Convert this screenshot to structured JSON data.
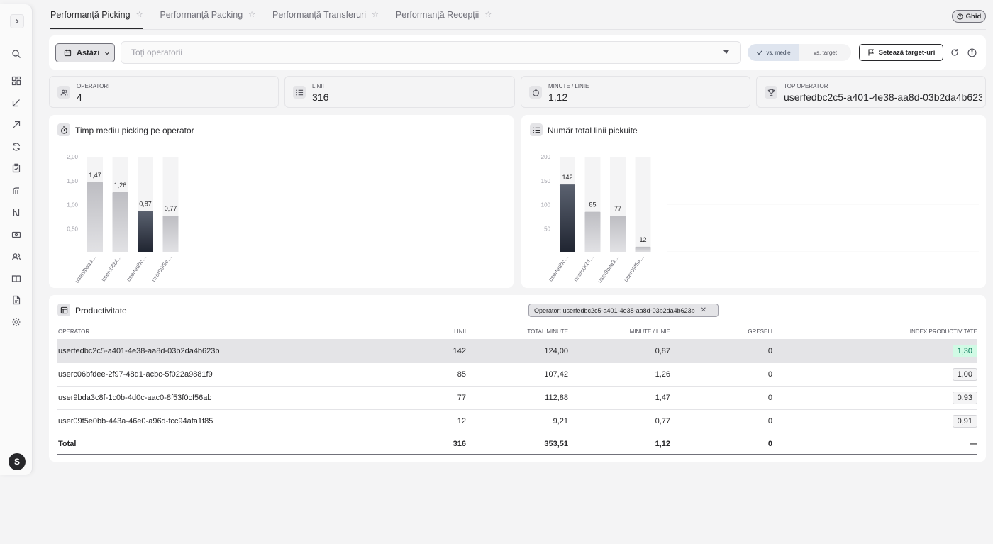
{
  "tabs": [
    {
      "label": "Performanță Picking",
      "active": true
    },
    {
      "label": "Performanță Packing",
      "active": false
    },
    {
      "label": "Performanță Transferuri",
      "active": false
    },
    {
      "label": "Performanță Recepții",
      "active": false
    }
  ],
  "header": {
    "ghid_label": "Ghid"
  },
  "filters": {
    "date_label": "Astăzi",
    "operator_placeholder": "Toți operatorii",
    "compare_options": [
      "vs. medie",
      "vs. target"
    ],
    "compare_selected": "vs. medie",
    "target_button_label": "Setează target-uri"
  },
  "kpis": [
    {
      "label": "Operatori",
      "value": "4",
      "icon": "users-icon"
    },
    {
      "label": "Linii",
      "value": "316",
      "icon": "list-icon"
    },
    {
      "label": "Minute / linie",
      "value": "1,12",
      "icon": "timer-icon"
    },
    {
      "label": "Top operator",
      "value": "userfedbc2c5-a401-4e38-aa8d-03b2da4b623b",
      "icon": "trophy-icon"
    }
  ],
  "user": {
    "avatar_initial": "S"
  },
  "chart_data": [
    {
      "type": "bar",
      "title": "Timp mediu picking pe operator",
      "categories": [
        "user9bda3…",
        "userc06bf…",
        "userfedbc…",
        "user09f5e…"
      ],
      "values": [
        1.47,
        1.26,
        0.87,
        0.77
      ],
      "value_labels": [
        "1,47",
        "1,26",
        "0,87",
        "0,77"
      ],
      "ylim": [
        0,
        2.0
      ],
      "yticks": [
        "2,00",
        "1,50",
        "1,00",
        "0,50"
      ],
      "highlight_index": 2,
      "grid": false
    },
    {
      "type": "bar",
      "title": "Număr total linii pickuite",
      "categories": [
        "userfedbc…",
        "userc06bf…",
        "user9bda3…",
        "user09f5e…"
      ],
      "values": [
        142,
        85,
        77,
        12
      ],
      "value_labels": [
        "142",
        "85",
        "77",
        "12"
      ],
      "ylim": [
        0,
        200
      ],
      "yticks": [
        "200",
        "150",
        "100",
        "50"
      ],
      "highlight_index": 0,
      "grid": true
    }
  ],
  "productivity": {
    "title": "Productivitate",
    "filter_chip": "Operator: userfedbc2c5-a401-4e38-aa8d-03b2da4b623b",
    "columns": [
      "Operator",
      "Linii",
      "Total minute",
      "Minute / linie",
      "Greșeli",
      "Index productivitate"
    ],
    "rows": [
      {
        "operator": "userfedbc2c5-a401-4e38-aa8d-03b2da4b623b",
        "linii": "142",
        "total_minute": "124,00",
        "min_linie": "0,87",
        "greseli": "0",
        "index": "1,30",
        "index_status": "good",
        "selected": true
      },
      {
        "operator": "userc06bfdee-2f97-48d1-acbc-5f022a9881f9",
        "linii": "85",
        "total_minute": "107,42",
        "min_linie": "1,26",
        "greseli": "0",
        "index": "1,00",
        "index_status": "neutral",
        "selected": false
      },
      {
        "operator": "user9bda3c8f-1c0b-4d0c-aac0-8f53f0cf56ab",
        "linii": "77",
        "total_minute": "112,88",
        "min_linie": "1,47",
        "greseli": "0",
        "index": "0,93",
        "index_status": "neutral",
        "selected": false
      },
      {
        "operator": "user09f5e0bb-443a-46e0-a96d-fcc94afa1f85",
        "linii": "12",
        "total_minute": "9,21",
        "min_linie": "0,77",
        "greseli": "0",
        "index": "0,91",
        "index_status": "neutral",
        "selected": false
      }
    ],
    "total": {
      "label": "Total",
      "linii": "316",
      "total_minute": "353,51",
      "min_linie": "1,12",
      "greseli": "0",
      "index": "—"
    }
  }
}
